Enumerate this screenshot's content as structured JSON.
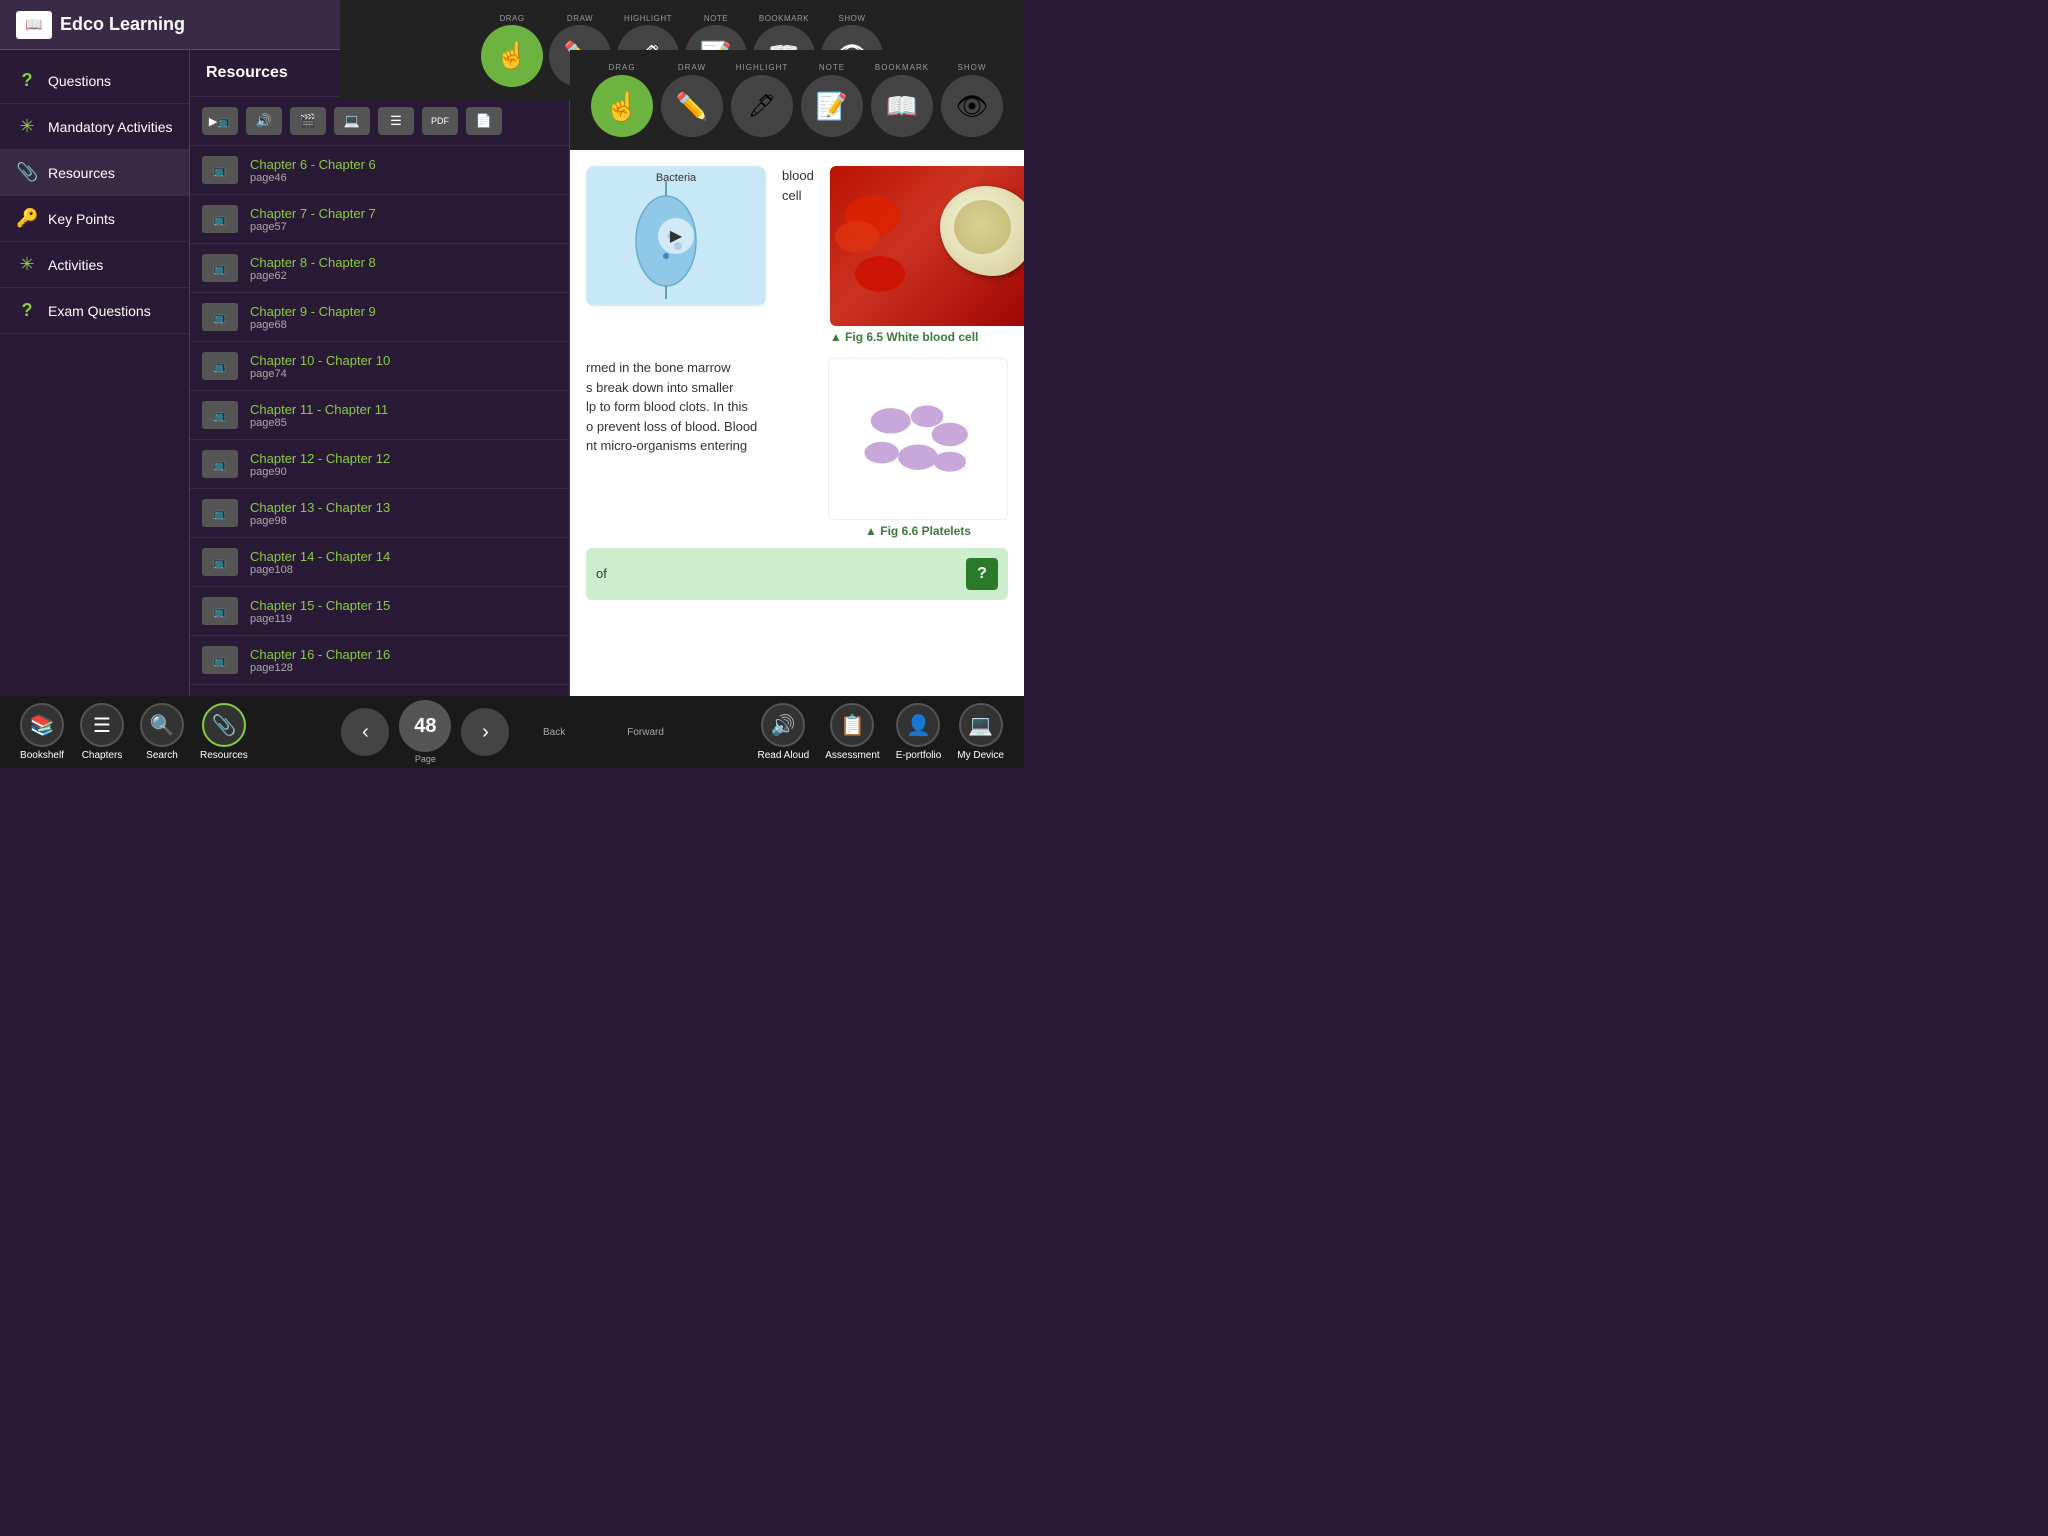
{
  "app": {
    "title": "Edco Learning",
    "logo_icon": "📖"
  },
  "toolbar_top": {
    "items": [
      {
        "id": "drag",
        "label": "DRAG",
        "icon": "☝",
        "active": true
      },
      {
        "id": "draw",
        "label": "DRAW",
        "icon": "✏",
        "active": false
      },
      {
        "id": "highlight",
        "label": "HIGHLIGHT",
        "icon": "🖍",
        "active": false
      },
      {
        "id": "note",
        "label": "NOTE",
        "icon": "📝",
        "active": false
      },
      {
        "id": "bookmark",
        "label": "BOOKMARK",
        "icon": "📖",
        "active": false
      },
      {
        "id": "show",
        "label": "SHOW",
        "icon": "👁",
        "active": false
      }
    ]
  },
  "sidebar": {
    "items": [
      {
        "id": "questions",
        "label": "Questions",
        "icon": "?"
      },
      {
        "id": "mandatory-activities",
        "label": "Mandatory Activities",
        "icon": "✳"
      },
      {
        "id": "resources",
        "label": "Resources",
        "icon": "📎"
      },
      {
        "id": "key-points",
        "label": "Key Points",
        "icon": "🔑"
      },
      {
        "id": "activities",
        "label": "Activities",
        "icon": "✳"
      },
      {
        "id": "exam-questions",
        "label": "Exam Questions",
        "icon": "?"
      }
    ]
  },
  "resources_panel": {
    "title": "Resources",
    "chapters": [
      {
        "title": "Chapter 6 - Chapter 6",
        "page": "page46"
      },
      {
        "title": "Chapter 7 - Chapter 7",
        "page": "page57"
      },
      {
        "title": "Chapter 8 - Chapter 8",
        "page": "page62"
      },
      {
        "title": "Chapter 9 - Chapter 9",
        "page": "page68"
      },
      {
        "title": "Chapter 10 - Chapter 10",
        "page": "page74"
      },
      {
        "title": "Chapter 11 - Chapter 11",
        "page": "page85"
      },
      {
        "title": "Chapter 12 - Chapter 12",
        "page": "page90"
      },
      {
        "title": "Chapter 13 - Chapter 13",
        "page": "page98"
      },
      {
        "title": "Chapter 14 - Chapter 14",
        "page": "page108"
      },
      {
        "title": "Chapter 15 - Chapter 15",
        "page": "page119"
      },
      {
        "title": "Chapter 16 - Chapter 16",
        "page": "page128"
      }
    ]
  },
  "content": {
    "bacteria_label": "Bacteria",
    "fig65_label": "▲ Fig 6.5 White blood cell",
    "fig66_label": "▲ Fig 6.6 Platelets",
    "text1": "blood cell",
    "text2": "rmed in the bone marrow",
    "text3": "s break down into smaller",
    "text4": "lp to form blood clots. In this",
    "text5": "o prevent loss of blood. Blood",
    "text6": "nt micro-organisms entering",
    "question_text": "of",
    "question_placeholder": "of"
  },
  "bottom_bar": {
    "page_number": "48",
    "page_label": "Page",
    "back_label": "Back",
    "forward_label": "Forward",
    "left_buttons": [
      {
        "id": "bookshelf",
        "label": "Bookshelf",
        "icon": "📚"
      },
      {
        "id": "chapters",
        "label": "Chapters",
        "icon": "☰"
      },
      {
        "id": "search",
        "label": "Search",
        "icon": "🔍"
      },
      {
        "id": "resources-btn",
        "label": "Resources",
        "icon": "📎"
      }
    ],
    "right_buttons": [
      {
        "id": "read-aloud",
        "label": "Read Aloud",
        "icon": "🔊"
      },
      {
        "id": "assessment",
        "label": "Assessment",
        "icon": "📋"
      },
      {
        "id": "eportfolio",
        "label": "E-portfolio",
        "icon": "👤"
      },
      {
        "id": "my-device",
        "label": "My Device",
        "icon": "💻"
      }
    ]
  }
}
